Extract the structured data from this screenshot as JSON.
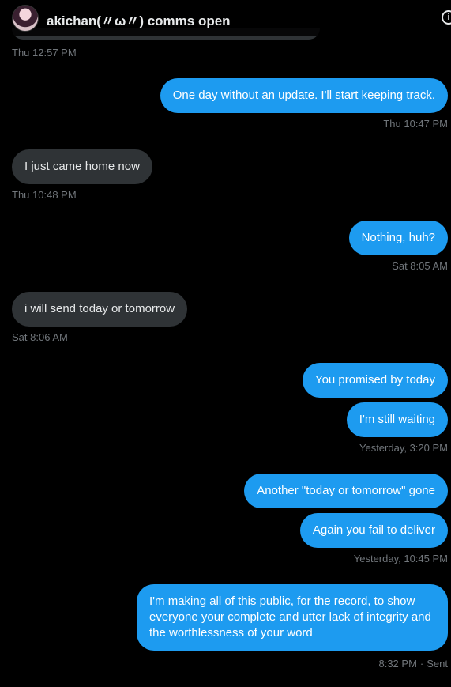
{
  "header": {
    "title": "akichan(〃ω〃) comms open",
    "info_icon": "info-icon"
  },
  "messages": [
    {
      "id": "m0",
      "timestamp": "Thu 12:57 PM"
    },
    {
      "id": "m1",
      "text": "One day without an update. I'll start keeping track.",
      "timestamp": "Thu 10:47 PM"
    },
    {
      "id": "m2",
      "text": "I just came home now",
      "timestamp": "Thu 10:48 PM"
    },
    {
      "id": "m3",
      "text": "Nothing, huh?",
      "timestamp": "Sat 8:05 AM"
    },
    {
      "id": "m4",
      "text": "i will send today or tomorrow",
      "timestamp": "Sat 8:06 AM"
    },
    {
      "id": "m5",
      "text": "You promised by today"
    },
    {
      "id": "m6",
      "text": "I'm still waiting",
      "timestamp": "Yesterday, 3:20 PM"
    },
    {
      "id": "m7",
      "text": "Another \"today or tomorrow\" gone"
    },
    {
      "id": "m8",
      "text": "Again you fail to deliver",
      "timestamp": "Yesterday, 10:45 PM"
    },
    {
      "id": "m9",
      "text": "I'm making all of this public, for the record, to show everyone your complete and utter lack of integrity and the worthlessness of your word",
      "timestamp": "8:32 PM",
      "status": "Sent"
    }
  ],
  "colors": {
    "outgoing_bubble": "#1d9bf0",
    "incoming_bubble": "#2f3336",
    "timestamp": "#71767b",
    "background": "#000000"
  }
}
